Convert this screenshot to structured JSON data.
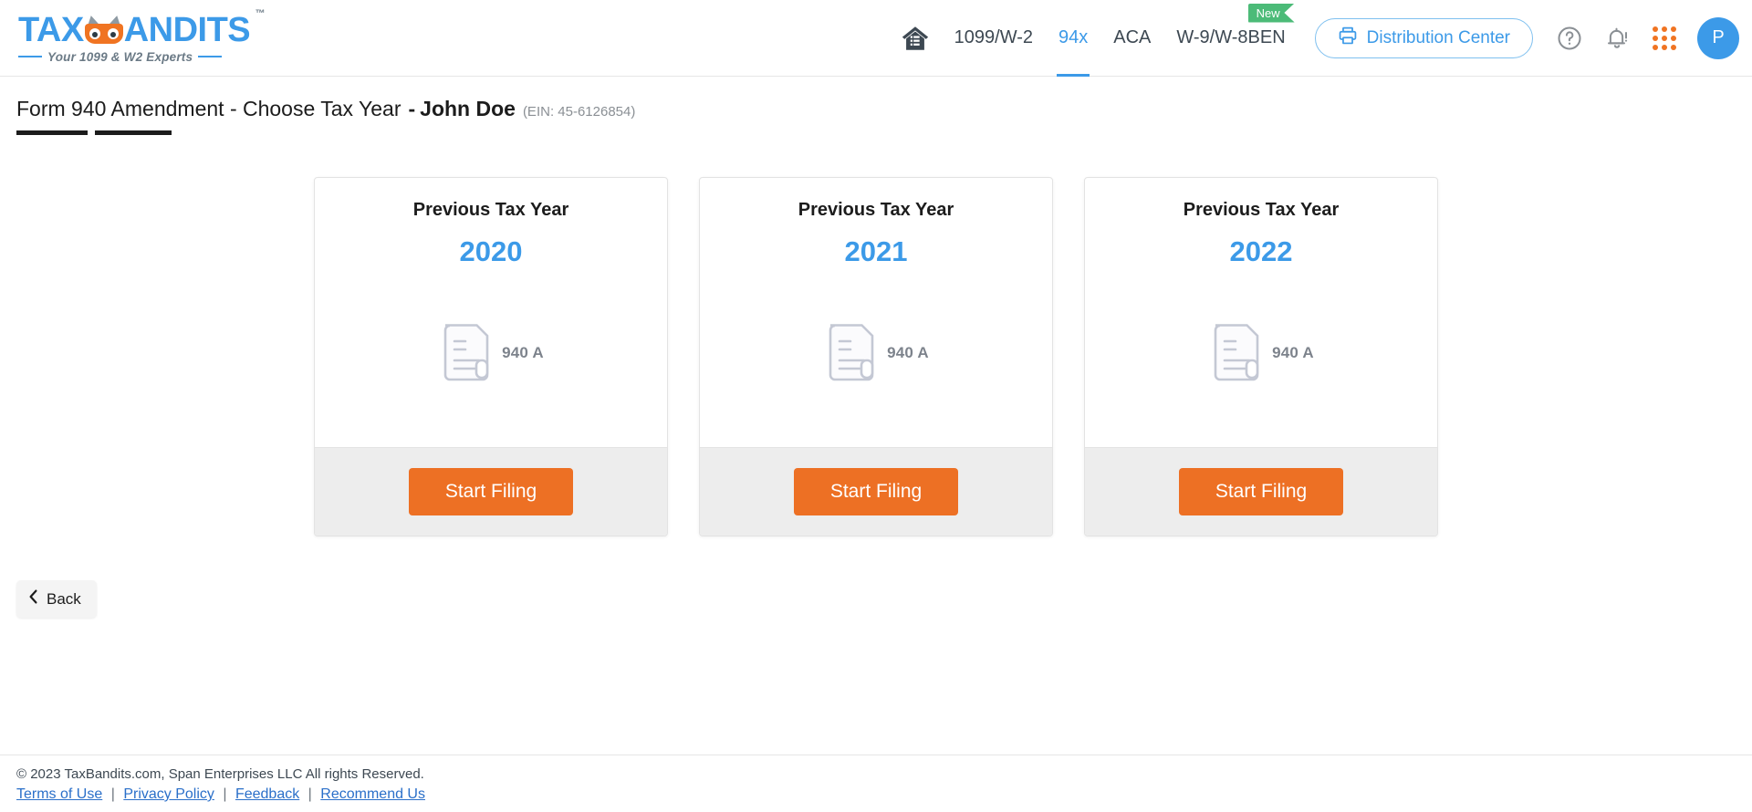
{
  "header": {
    "logo": {
      "text_left": "TAX",
      "text_right": "ANDITS",
      "tm": "™",
      "tagline": "Your 1099 & W2 Experts",
      "owl_icon": "owl-mask-icon"
    },
    "nav": [
      {
        "label": "1099/W-2",
        "active": false
      },
      {
        "label": "94x",
        "active": true
      },
      {
        "label": "ACA",
        "active": false
      },
      {
        "label": "W-9/W-8BEN",
        "active": false,
        "badge": "New"
      }
    ],
    "home_icon": "home-icon",
    "distribution_button": {
      "label": "Distribution Center",
      "icon": "printer-icon"
    },
    "help_icon": "help-circle-icon",
    "notification_icon": "bell-alert-icon",
    "apps_icon": "grid-apps-icon",
    "avatar": {
      "initial": "P"
    },
    "accent_blue": "#3c9ae8",
    "badge_green": "#4cbb78",
    "accent_orange": "#f07422"
  },
  "page": {
    "title": "Form 940 Amendment - Choose Tax Year",
    "separator": "-",
    "business_name": "John Doe",
    "ein": "(EIN: 45-6126854)"
  },
  "cards": [
    {
      "label": "Previous Tax Year",
      "year": "2020",
      "doc_icon": "document-940a-icon",
      "doc_label": "940 A",
      "button_label": "Start Filing"
    },
    {
      "label": "Previous Tax Year",
      "year": "2021",
      "doc_icon": "document-940a-icon",
      "doc_label": "940 A",
      "button_label": "Start Filing"
    },
    {
      "label": "Previous Tax Year",
      "year": "2022",
      "doc_icon": "document-940a-icon",
      "doc_label": "940 A",
      "button_label": "Start Filing"
    }
  ],
  "back": {
    "label": "Back",
    "icon": "chevron-left-icon"
  },
  "footer": {
    "copyright": "© 2023 TaxBandits.com, Span Enterprises LLC All rights Reserved.",
    "links": [
      {
        "label": "Terms of Use"
      },
      {
        "label": "Privacy Policy"
      },
      {
        "label": "Feedback"
      },
      {
        "label": "Recommend Us"
      }
    ],
    "separator": "|"
  }
}
